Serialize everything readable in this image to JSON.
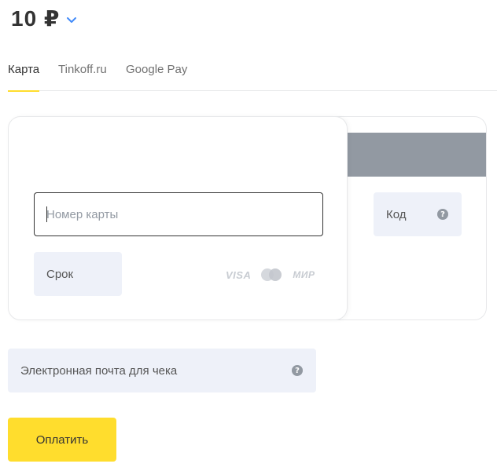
{
  "amount": {
    "value": "10 ₽"
  },
  "tabs": [
    {
      "label": "Карта",
      "active": true
    },
    {
      "label": "Tinkoff.ru",
      "active": false
    },
    {
      "label": "Google Pay",
      "active": false
    }
  ],
  "card": {
    "pan_placeholder": "Номер карты",
    "expiry_label": "Срок",
    "cvc_label": "Код",
    "logos": {
      "visa": "VISA",
      "mir": "МИР"
    }
  },
  "email": {
    "label": "Электронная почта для чека"
  },
  "pay_button": {
    "label": "Оплатить"
  },
  "colors": {
    "accent": "#ffdd2d",
    "link": "#428bf9",
    "field_bg": "#eef1f9",
    "stripe": "#9299a2"
  }
}
